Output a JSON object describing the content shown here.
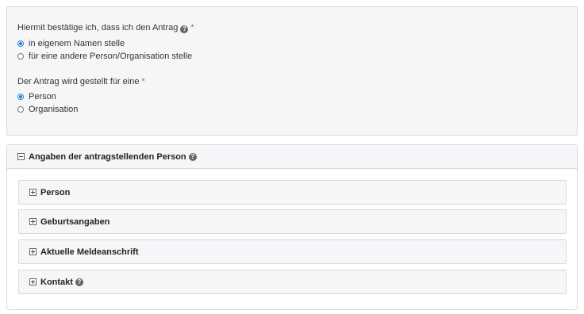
{
  "confirm": {
    "question": "Hiermit bestätige ich, dass ich den Antrag",
    "required_mark": "*",
    "options": [
      {
        "label": "in eigenem Namen stelle",
        "checked": true
      },
      {
        "label": "für eine andere Person/Organisation stelle",
        "checked": false
      }
    ]
  },
  "type": {
    "question": "Der Antrag wird gestellt für eine",
    "required_mark": "*",
    "options": [
      {
        "label": "Person",
        "checked": true
      },
      {
        "label": "Organisation",
        "checked": false
      }
    ]
  },
  "applicant_section": {
    "title": "Angaben der antragstellenden Person",
    "subsections": [
      {
        "label": "Person"
      },
      {
        "label": "Geburtsangaben"
      },
      {
        "label": "Aktuelle Meldeanschrift"
      },
      {
        "label": "Kontakt"
      }
    ]
  },
  "help_glyph": "?"
}
